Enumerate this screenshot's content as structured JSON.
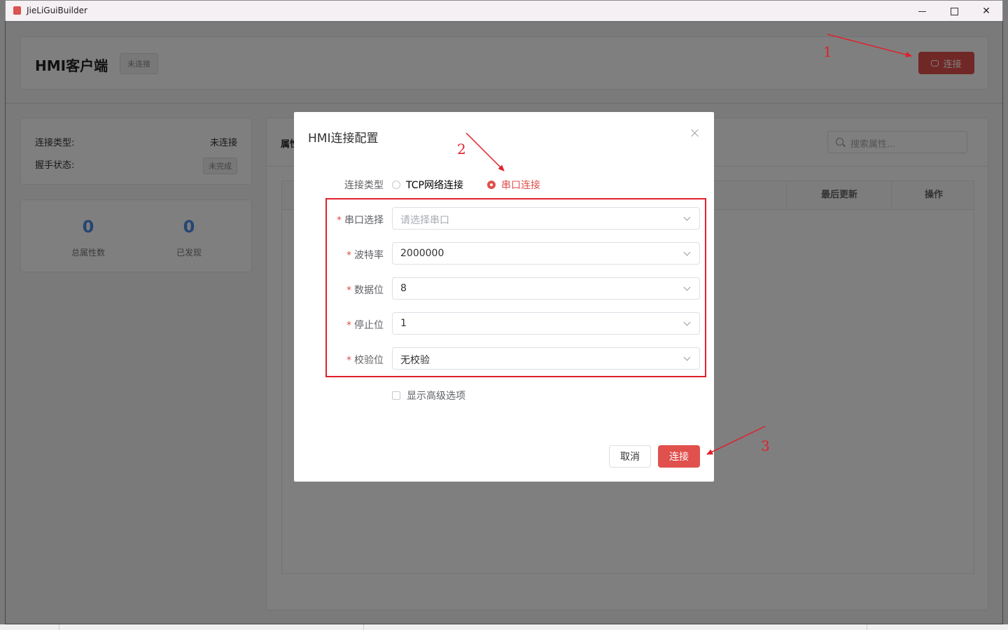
{
  "window": {
    "title": "JieLiGuiBuilder",
    "minimize": "─",
    "maximize": "☐",
    "close": "✕"
  },
  "header": {
    "title": "HMI客户端",
    "status_tag": "未连接",
    "connect_button": "连接",
    "connect_icon": "link-icon"
  },
  "status_panel": {
    "connection_type_label": "连接类型:",
    "connection_type_value": "未连接",
    "handshake_label": "握手状态:",
    "handshake_value": "未完成"
  },
  "stats": [
    {
      "value": "0",
      "label": "总属性数"
    },
    {
      "value": "0",
      "label": "已发现"
    }
  ],
  "main": {
    "label": "属性",
    "search_placeholder": "搜索属性...",
    "columns": [
      "最后更新",
      "操作"
    ]
  },
  "dialog": {
    "title": "HMI连接配置",
    "connection_type_label": "连接类型",
    "radio_options": [
      {
        "label": "TCP网络连接",
        "checked": false
      },
      {
        "label": "串口连接",
        "checked": true
      }
    ],
    "required_mark": "*",
    "fields": [
      {
        "label": "串口选择",
        "value": "",
        "placeholder": "请选择串口"
      },
      {
        "label": "波特率",
        "value": "2000000",
        "placeholder": ""
      },
      {
        "label": "数据位",
        "value": "8",
        "placeholder": ""
      },
      {
        "label": "停止位",
        "value": "1",
        "placeholder": ""
      },
      {
        "label": "校验位",
        "value": "无校验",
        "placeholder": ""
      }
    ],
    "advanced_checkbox": "显示高级选项",
    "cancel_button": "取消",
    "ok_button": "连接"
  },
  "annotations": [
    "1",
    "2",
    "3"
  ],
  "colors": {
    "accent": "#e0504c",
    "annotation": "#e0202a",
    "stat": "#4a8de8"
  }
}
